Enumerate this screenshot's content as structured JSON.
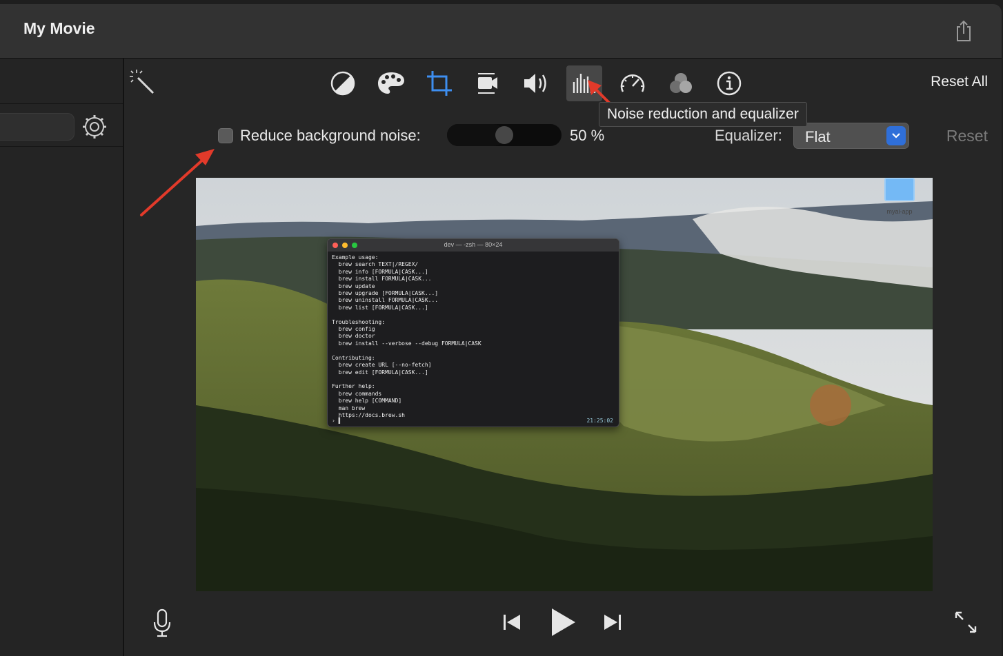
{
  "window": {
    "title": "My Movie"
  },
  "toolbar": {
    "icons": [
      {
        "name": "color-balance-icon"
      },
      {
        "name": "color-correction-icon"
      },
      {
        "name": "crop-icon"
      },
      {
        "name": "stabilization-icon"
      },
      {
        "name": "volume-icon"
      },
      {
        "name": "noise-reduction-equalizer-icon"
      },
      {
        "name": "speed-icon"
      },
      {
        "name": "clip-filter-icon"
      },
      {
        "name": "clip-info-icon"
      }
    ],
    "reset_all_label": "Reset All",
    "tooltip": "Noise reduction and equalizer"
  },
  "noise": {
    "checkbox_label": "Reduce background noise:",
    "checked": false,
    "slider_value": 50,
    "value_text": "50  %"
  },
  "equalizer": {
    "label": "Equalizer:",
    "value": "Flat"
  },
  "reset_label": "Reset",
  "desktop": {
    "icon_label": "myai-app"
  },
  "terminal": {
    "title": "dev — -zsh — 80×24",
    "lines": "Example usage:\n  brew search TEXT|/REGEX/\n  brew info [FORMULA|CASK...]\n  brew install FORMULA|CASK...\n  brew update\n  brew upgrade [FORMULA|CASK...]\n  brew uninstall FORMULA|CASK...\n  brew list [FORMULA|CASK...]\n\nTroubleshooting:\n  brew config\n  brew doctor\n  brew install --verbose --debug FORMULA|CASK\n\nContributing:\n  brew create URL [--no-fetch]\n  brew edit [FORMULA|CASK...]\n\nFurther help:\n  brew commands\n  brew help [COMMAND]\n  man brew\n  https://docs.brew.sh",
    "prompt": "› ▌",
    "time": "21:25:02"
  },
  "colors": {
    "accent": "#2f6fd9",
    "annotation": "#e23a2a"
  }
}
